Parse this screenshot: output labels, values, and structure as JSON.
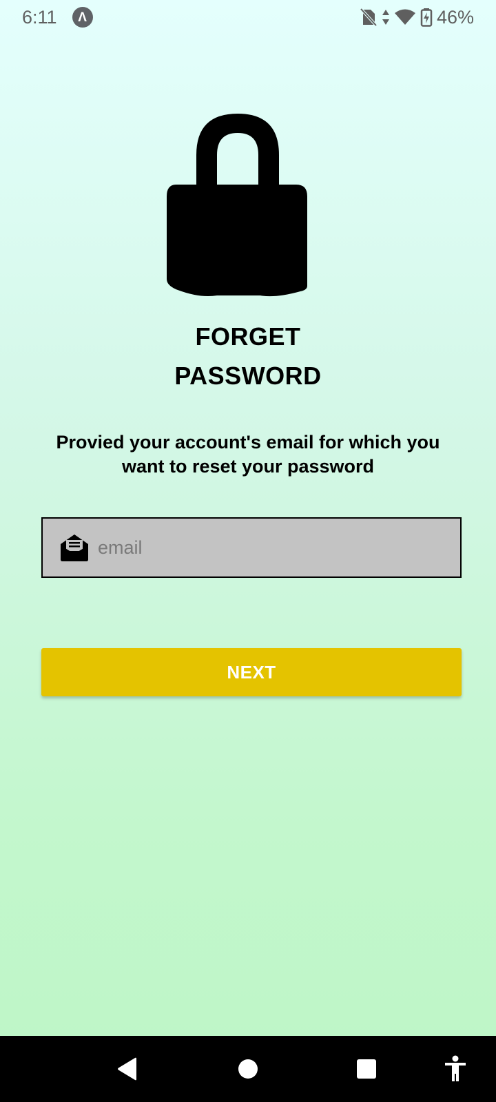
{
  "status_bar": {
    "time": "6:11",
    "app_badge": "Λ",
    "battery": "46%",
    "icons": [
      "no-sim-icon",
      "data-arrows-icon",
      "wifi-icon",
      "battery-charging-icon"
    ]
  },
  "header": {
    "icon": "lock-icon",
    "title_line1": "FORGET",
    "title_line2": "PASSWORD"
  },
  "description": "Provied your account's email for which you want to reset your password",
  "email": {
    "icon": "open-mail-icon",
    "placeholder": "email",
    "value": ""
  },
  "next_button": {
    "label": "NEXT"
  },
  "nav_bar": {
    "items": [
      "back-icon",
      "home-icon",
      "recents-icon",
      "accessibility-icon"
    ]
  },
  "colors": {
    "background_top": "#e4fffd",
    "background_bottom": "#bdf6c6",
    "input_background": "#c3c3c3",
    "button": "#e4c300",
    "button_text": "#ffffff"
  }
}
